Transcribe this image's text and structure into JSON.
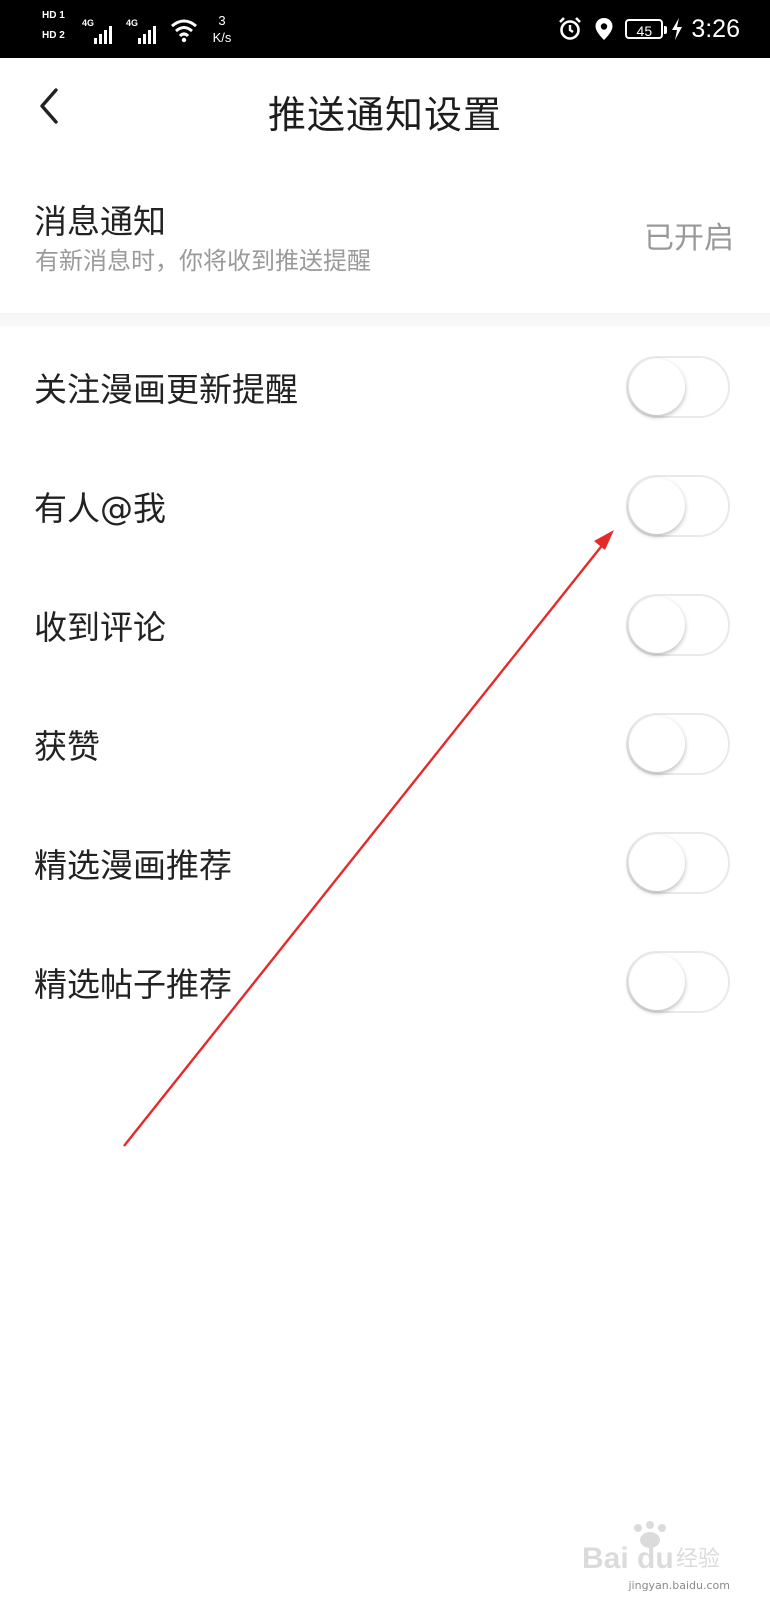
{
  "status_bar": {
    "hd1": "HD 1",
    "hd2": "HD 2",
    "net1": "4G",
    "net2": "4G",
    "speed_value": "3",
    "speed_unit": "K/s",
    "battery": "45",
    "time": "3:26"
  },
  "header": {
    "title": "推送通知设置",
    "back_icon": "chevron-left-icon"
  },
  "message_notification": {
    "title": "消息通知",
    "description": "有新消息时，你将收到推送提醒",
    "status": "已开启"
  },
  "toggles": [
    {
      "label": "关注漫画更新提醒",
      "on": false
    },
    {
      "label": "有人@我",
      "on": false
    },
    {
      "label": "收到评论",
      "on": false
    },
    {
      "label": "获赞",
      "on": false
    },
    {
      "label": "精选漫画推荐",
      "on": false
    },
    {
      "label": "精选帖子推荐",
      "on": false
    }
  ],
  "colors": {
    "status_bar_bg": "#000000",
    "arrow": "#e52a2a",
    "title_text": "#1d1d1d",
    "secondary_text": "#9a9a9a"
  },
  "watermark": {
    "logo": "Baidu经验",
    "url": "jingyan.baidu.com"
  }
}
